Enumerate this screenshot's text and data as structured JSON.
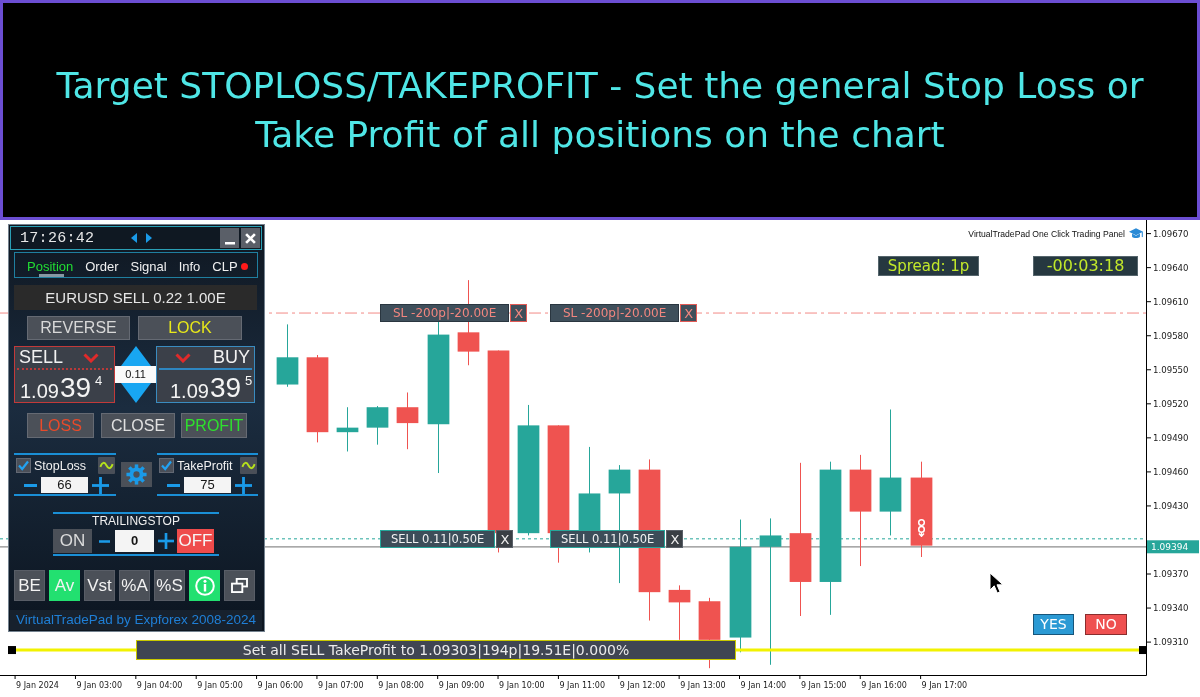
{
  "banner": {
    "title": "Target STOPLOSS/TAKEPROFIT - Set the general Stop Loss or Take Profit of all positions on the chart"
  },
  "panel": {
    "clock": "17:26:42",
    "tabs": [
      {
        "label": "Position",
        "selected": true,
        "alert": false
      },
      {
        "label": "Order",
        "selected": false,
        "alert": false
      },
      {
        "label": "Signal",
        "selected": false,
        "alert": false
      },
      {
        "label": "Info",
        "selected": false,
        "alert": false
      },
      {
        "label": "CLP",
        "selected": false,
        "alert": true
      }
    ],
    "summary": "EURUSD SELL 0.22 1.00E",
    "reverse_button": "REVERSE",
    "lock_button": "LOCK",
    "sell": {
      "label": "SELL",
      "price": {
        "prefix": "1.09",
        "digits": "39",
        "pip": "4"
      }
    },
    "lot": "0.11",
    "buy": {
      "label": "BUY",
      "price": {
        "prefix": "1.09",
        "digits": "39",
        "pip": "5"
      }
    },
    "loss_button": "LOSS",
    "close_button": "CLOSE",
    "profit_button": "PROFIT",
    "stop_loss": {
      "label": "StopLoss",
      "checked": true,
      "value": "66"
    },
    "take_profit": {
      "label": "TakeProfit",
      "checked": true,
      "value": "75"
    },
    "trailing_stop": {
      "label": "TRAILINGSTOP",
      "on_label": "ON",
      "off_label": "OFF",
      "value": "0",
      "enabled": false
    },
    "tools": [
      {
        "kind": "text",
        "label": "BE",
        "active": false
      },
      {
        "kind": "text",
        "label": "Av",
        "active": true
      },
      {
        "kind": "text",
        "label": "Vst",
        "active": false
      },
      {
        "kind": "text",
        "label": "%A",
        "active": false
      },
      {
        "kind": "text",
        "label": "%S",
        "active": false
      },
      {
        "kind": "info",
        "active": true
      },
      {
        "kind": "windows",
        "active": false
      }
    ],
    "footer": "VirtualTradePad by Expforex 2008-2024"
  },
  "chart": {
    "caption": "VirtualTradePad One Click Trading Panel",
    "spread": "Spread: 1p",
    "timer": "-00:03:18",
    "stop_loss_tags": [
      {
        "text": "SL -200p|-20.00E",
        "close": "X"
      },
      {
        "text": "SL -200p|-20.00E",
        "close": "X"
      }
    ],
    "position_tags": [
      {
        "text": "SELL 0.11|0.50E",
        "close": "X"
      },
      {
        "text": "SELL 0.11|0.50E",
        "close": "X"
      }
    ],
    "price_tag": "1.09394",
    "target_label": "Set all SELL TakeProfit to 1.09303|194p|19.51E|0.000%",
    "yes_button": "YES",
    "no_button": "NO",
    "chart_data": {
      "type": "candlestick",
      "categories": [
        "9 Jan 2024",
        null,
        "9 Jan 03:00",
        null,
        "9 Jan 04:00",
        null,
        "9 Jan 05:00",
        null,
        "9 Jan 06:00",
        null,
        "9 Jan 07:00",
        null,
        "9 Jan 08:00",
        null,
        "9 Jan 09:00",
        null,
        "9 Jan 10:00",
        null,
        "9 Jan 11:00",
        null,
        "9 Jan 12:00",
        null,
        "9 Jan 13:00",
        null,
        "9 Jan 14:00",
        null,
        "9 Jan 15:00",
        null,
        "9 Jan 16:00",
        null,
        "9 Jan 17:00",
        null,
        null,
        null,
        null,
        null,
        null,
        null
      ],
      "ylim": [
        1.09281,
        1.09682
      ],
      "yticks": [
        {
          "value": 1.0967,
          "label": "1.09670"
        },
        {
          "value": 1.0964,
          "label": "1.09640"
        },
        {
          "value": 1.0961,
          "label": "1.09610"
        },
        {
          "value": 1.0958,
          "label": "1.09580"
        },
        {
          "value": 1.0955,
          "label": "1.09550"
        },
        {
          "value": 1.0952,
          "label": "1.09520"
        },
        {
          "value": 1.0949,
          "label": "1.09490"
        },
        {
          "value": 1.0946,
          "label": "1.09460"
        },
        {
          "value": 1.0943,
          "label": "1.09430"
        },
        {
          "value": 1.0937,
          "label": "1.09370"
        },
        {
          "value": 1.0934,
          "label": "1.09340"
        },
        {
          "value": 1.0931,
          "label": "1.09310"
        }
      ],
      "ref_lines": [
        {
          "axis": "y",
          "value": 1.096,
          "color": "#f28a86"
        },
        {
          "axis": "y",
          "value": 1.09401,
          "color": "#26a69a"
        },
        {
          "axis": "y",
          "value": 1.09394,
          "color": "#8c8c8c"
        },
        {
          "axis": "y",
          "value": 1.09303,
          "color": "#f2f200"
        }
      ]
    }
  }
}
